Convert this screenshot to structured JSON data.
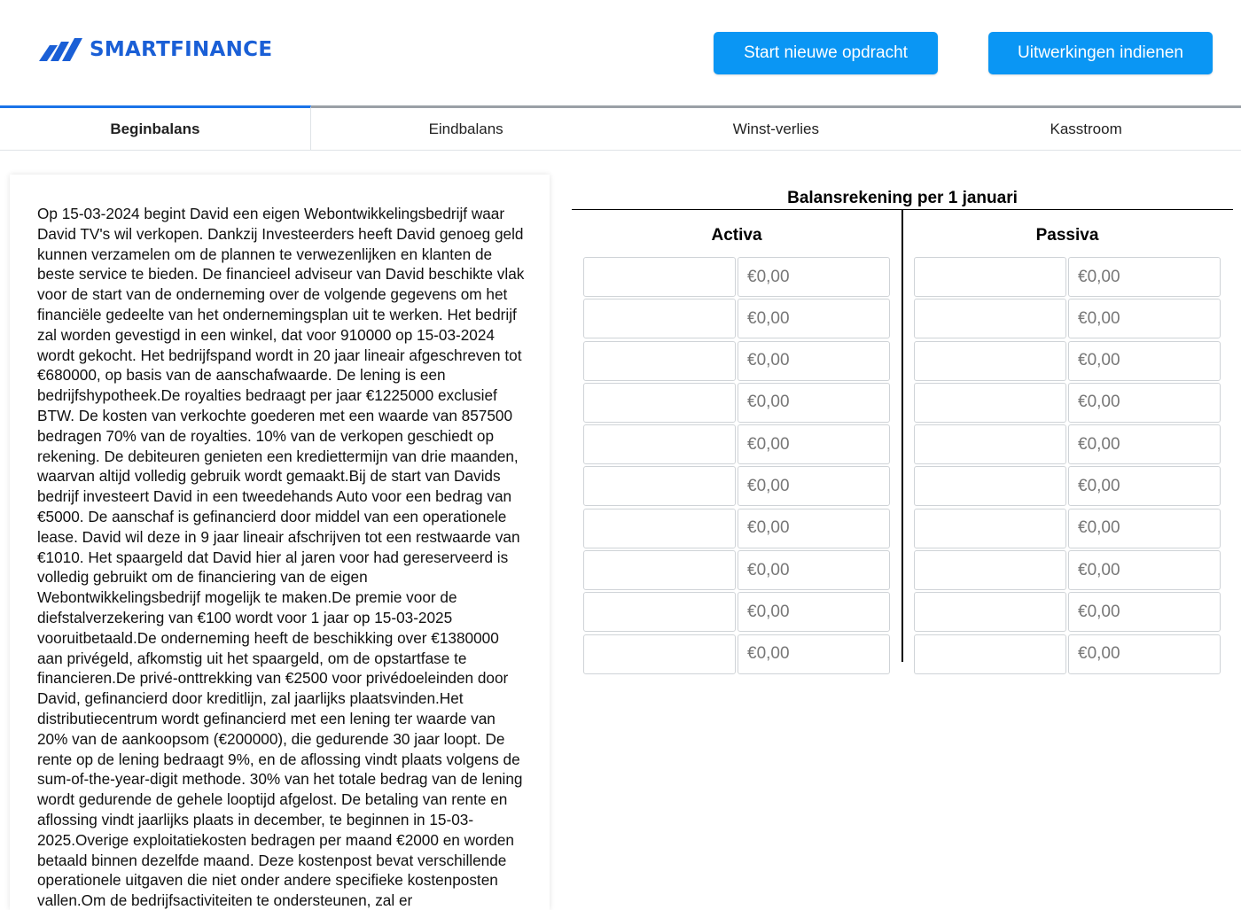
{
  "header": {
    "logo_text": "SMARTFINANCE",
    "logo_icon": "logo-slashes-icon",
    "start_button": "Start nieuwe opdracht",
    "submit_button": "Uitwerkingen indienen"
  },
  "tabs": [
    {
      "label": "Beginbalans",
      "active": true
    },
    {
      "label": "Eindbalans",
      "active": false
    },
    {
      "label": "Winst-verlies",
      "active": false
    },
    {
      "label": "Kasstroom",
      "active": false
    }
  ],
  "story": {
    "text": "Op 15-03-2024 begint David een eigen Webontwikkelingsbedrijf waar David TV's wil verkopen. Dankzij Investeerders heeft David genoeg geld kunnen verzamelen om de plannen te verwezenlijken en klanten de beste service te bieden. De financieel adviseur van David beschikte vlak voor de start van de onderneming over de volgende gegevens om het financiële gedeelte van het ondernemingsplan uit te werken. Het bedrijf zal worden gevestigd in een winkel, dat voor 910000 op 15-03-2024 wordt gekocht. Het bedrijfspand wordt in 20 jaar lineair afgeschreven tot €680000, op basis van de aanschafwaarde. De lening is een bedrijfshypotheek.De royalties bedraagt per jaar €1225000 exclusief BTW. De kosten van verkochte goederen met een waarde van 857500 bedragen 70% van de royalties. 10% van de verkopen geschiedt op rekening. De debiteuren genieten een krediettermijn van drie maanden, waarvan altijd volledig gebruik wordt gemaakt.Bij de start van Davids bedrijf investeert David in een tweedehands Auto voor een bedrag van €5000. De aanschaf is gefinancierd door middel van een operationele lease. David wil deze in 9 jaar lineair afschrijven tot een restwaarde van €1010. Het spaargeld dat David hier al jaren voor had gereserveerd is volledig gebruikt om de financiering van de eigen Webontwikkelingsbedrijf mogelijk te maken.De premie voor de diefstalverzekering van €100 wordt voor 1 jaar op 15-03-2025 vooruitbetaald.De onderneming heeft de beschikking over €1380000 aan privégeld, afkomstig uit het spaargeld, om de opstartfase te financieren.De privé-onttrekking van €2500 voor privédoeleinden door David, gefinancierd door kreditlijn, zal jaarlijks plaatsvinden.Het distributiecentrum wordt gefinancierd met een lening ter waarde van 20% van de aankoopsom (€200000), die gedurende 30 jaar loopt. De rente op de lening bedraagt 9%, en de aflossing vindt plaats volgens de sum-of-the-year-digit methode. 30% van het totale bedrag van de lening wordt gedurende de gehele looptijd afgelost. De betaling van rente en aflossing vindt jaarlijks plaats in december, te beginnen in 15-03-2025.Overige exploitatiekosten bedragen per maand €2000 en worden betaald binnen dezelfde maand. Deze kostenpost bevat verschillende operationele uitgaven die niet onder andere specifieke kostenposten vallen.Om de bedrijfsactiviteiten te ondersteunen, zal er"
  },
  "balance": {
    "title": "Balansrekening per 1 januari",
    "activa": {
      "header": "Activa",
      "rows": [
        {
          "name": "",
          "amount": "€0,00"
        },
        {
          "name": "",
          "amount": "€0,00"
        },
        {
          "name": "",
          "amount": "€0,00"
        },
        {
          "name": "",
          "amount": "€0,00"
        },
        {
          "name": "",
          "amount": "€0,00"
        },
        {
          "name": "",
          "amount": "€0,00"
        },
        {
          "name": "",
          "amount": "€0,00"
        },
        {
          "name": "",
          "amount": "€0,00"
        },
        {
          "name": "",
          "amount": "€0,00"
        },
        {
          "name": "",
          "amount": "€0,00"
        }
      ]
    },
    "passiva": {
      "header": "Passiva",
      "rows": [
        {
          "name": "",
          "amount": "€0,00"
        },
        {
          "name": "",
          "amount": "€0,00"
        },
        {
          "name": "",
          "amount": "€0,00"
        },
        {
          "name": "",
          "amount": "€0,00"
        },
        {
          "name": "",
          "amount": "€0,00"
        },
        {
          "name": "",
          "amount": "€0,00"
        },
        {
          "name": "",
          "amount": "€0,00"
        },
        {
          "name": "",
          "amount": "€0,00"
        },
        {
          "name": "",
          "amount": "€0,00"
        },
        {
          "name": "",
          "amount": "€0,00"
        }
      ]
    }
  },
  "colors": {
    "brand": "#1a5fd6",
    "button": "#0a96f4",
    "active_tab_indicator": "#1a73e8"
  }
}
